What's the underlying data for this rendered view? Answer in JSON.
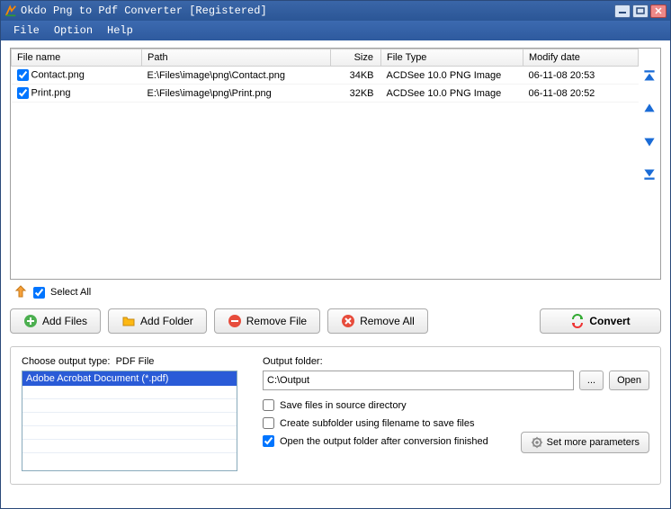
{
  "titlebar": {
    "title": "Okdo Png to Pdf Converter [Registered]"
  },
  "menu": {
    "file": "File",
    "option": "Option",
    "help": "Help"
  },
  "grid": {
    "headers": {
      "filename": "File name",
      "path": "Path",
      "size": "Size",
      "filetype": "File Type",
      "modify": "Modify date"
    },
    "rows": [
      {
        "name": "Contact.png",
        "path": "E:\\Files\\image\\png\\Contact.png",
        "size": "34KB",
        "type": "ACDSee 10.0 PNG Image",
        "modify": "06-11-08 20:53"
      },
      {
        "name": "Print.png",
        "path": "E:\\Files\\image\\png\\Print.png",
        "size": "32KB",
        "type": "ACDSee 10.0 PNG Image",
        "modify": "06-11-08 20:52"
      }
    ]
  },
  "selectall": "Select All",
  "buttons": {
    "addfiles": "Add Files",
    "addfolder": "Add Folder",
    "removefile": "Remove File",
    "removeall": "Remove All",
    "convert": "Convert"
  },
  "output": {
    "choose_label": "Choose output type:",
    "pdf_file": "PDF File",
    "type_item": "Adobe Acrobat Document (*.pdf)",
    "folder_label": "Output folder:",
    "folder_value": "C:\\Output",
    "browse": "...",
    "open": "Open",
    "save_source": "Save files in source directory",
    "create_subfolder": "Create subfolder using filename to save files",
    "open_after": "Open the output folder after conversion finished",
    "more_params": "Set more parameters"
  }
}
